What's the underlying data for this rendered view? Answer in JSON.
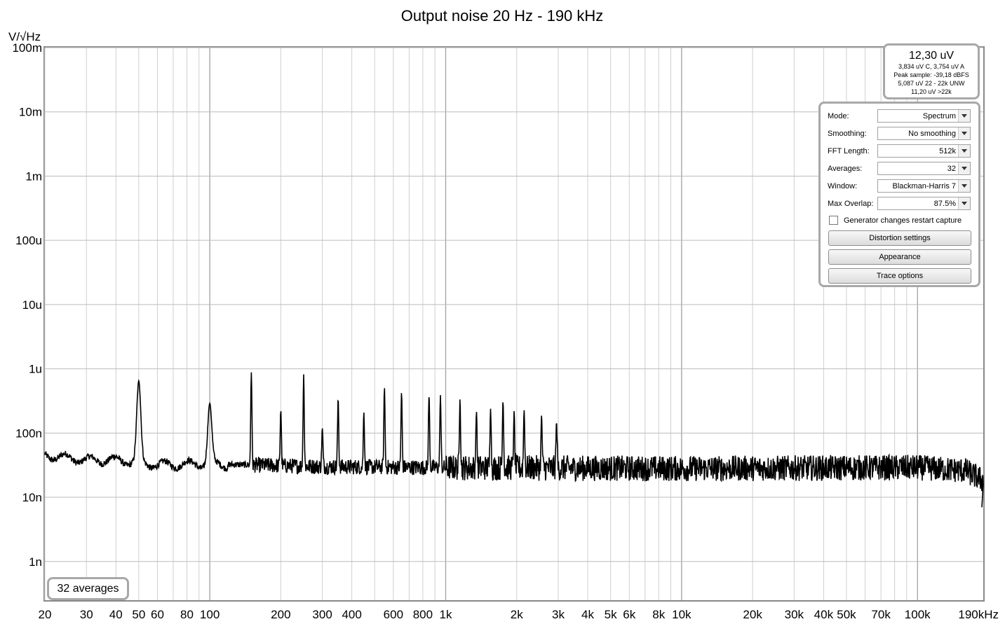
{
  "chart_data": {
    "type": "line",
    "title": "Output noise 20 Hz - 190 kHz",
    "ylabel": "V/√Hz",
    "xlabel": "",
    "x_scale": "log",
    "y_scale": "log",
    "xlim": [
      20,
      190000
    ],
    "ylim": [
      2.5e-10,
      0.1
    ],
    "grid": true,
    "x_ticks": [
      {
        "v": 20,
        "label": "20"
      },
      {
        "v": 30,
        "label": "30"
      },
      {
        "v": 40,
        "label": "40"
      },
      {
        "v": 50,
        "label": "50"
      },
      {
        "v": 60,
        "label": "60"
      },
      {
        "v": 80,
        "label": "80"
      },
      {
        "v": 100,
        "label": "100"
      },
      {
        "v": 200,
        "label": "200"
      },
      {
        "v": 300,
        "label": "300"
      },
      {
        "v": 400,
        "label": "400"
      },
      {
        "v": 600,
        "label": "600"
      },
      {
        "v": 800,
        "label": "800"
      },
      {
        "v": 1000,
        "label": "1k"
      },
      {
        "v": 2000,
        "label": "2k"
      },
      {
        "v": 3000,
        "label": "3k"
      },
      {
        "v": 4000,
        "label": "4k"
      },
      {
        "v": 5000,
        "label": "5k"
      },
      {
        "v": 6000,
        "label": "6k"
      },
      {
        "v": 8000,
        "label": "8k"
      },
      {
        "v": 10000,
        "label": "10k"
      },
      {
        "v": 20000,
        "label": "20k"
      },
      {
        "v": 30000,
        "label": "30k"
      },
      {
        "v": 40000,
        "label": "40k"
      },
      {
        "v": 50000,
        "label": "50k"
      },
      {
        "v": 70000,
        "label": "70k"
      },
      {
        "v": 100000,
        "label": "100k"
      },
      {
        "v": 190000,
        "label": "190kHz"
      }
    ],
    "y_ticks": [
      {
        "v": 0.1,
        "label": "100m"
      },
      {
        "v": 0.01,
        "label": "10m"
      },
      {
        "v": 0.001,
        "label": "1m"
      },
      {
        "v": 0.0001,
        "label": "100u"
      },
      {
        "v": 1e-05,
        "label": "10u"
      },
      {
        "v": 1e-06,
        "label": "1u"
      },
      {
        "v": 1e-07,
        "label": "100n"
      },
      {
        "v": 1e-08,
        "label": "10n"
      },
      {
        "v": 1e-09,
        "label": "1n"
      }
    ],
    "series": [
      {
        "floor": [
          [
            20,
            4.5e-08
          ],
          [
            30,
            3.8e-08
          ],
          [
            40,
            3.8e-08
          ],
          [
            60,
            3.2e-08
          ],
          [
            100,
            3.3e-08
          ],
          [
            300,
            3e-08
          ],
          [
            1000,
            2.9e-08
          ],
          [
            10000,
            2.8e-08
          ],
          [
            100000,
            2.9e-08
          ],
          [
            160000,
            2.6e-08
          ],
          [
            190000,
            1.8e-08
          ],
          [
            192000,
            7e-09
          ]
        ],
        "peaks": [
          {
            "f": 50,
            "v": 6.5e-07
          },
          {
            "f": 100,
            "v": 2.9e-07
          },
          {
            "f": 150,
            "v": 8.8e-07
          },
          {
            "f": 200,
            "v": 2.3e-07
          },
          {
            "f": 250,
            "v": 8.2e-07
          },
          {
            "f": 300,
            "v": 1.2e-07
          },
          {
            "f": 350,
            "v": 3.5e-07
          },
          {
            "f": 450,
            "v": 2.1e-07
          },
          {
            "f": 550,
            "v": 5.1e-07
          },
          {
            "f": 650,
            "v": 4.3e-07
          },
          {
            "f": 850,
            "v": 3.9e-07
          },
          {
            "f": 950,
            "v": 3.9e-07
          },
          {
            "f": 1150,
            "v": 3.4e-07
          },
          {
            "f": 1350,
            "v": 2.2e-07
          },
          {
            "f": 1550,
            "v": 2.4e-07
          },
          {
            "f": 1750,
            "v": 3.2e-07
          },
          {
            "f": 1950,
            "v": 2.2e-07
          },
          {
            "f": 2150,
            "v": 2.3e-07
          },
          {
            "f": 2550,
            "v": 1.9e-07
          },
          {
            "f": 2950,
            "v": 1.5e-07
          }
        ]
      }
    ]
  },
  "meter": {
    "main": "12,30 uV",
    "line1": "3,834 uV C, 3,754 uV A",
    "line2": "Peak sample: -39,18 dBFS",
    "line3": "5,087 uV 22 - 22k UNW",
    "line4": "11,20 uV >22k"
  },
  "controls": {
    "mode_label": "Mode:",
    "mode_value": "Spectrum",
    "smoothing_label": "Smoothing:",
    "smoothing_value": "No  smoothing",
    "fft_label": "FFT Length:",
    "fft_value": "512k",
    "averages_label": "Averages:",
    "averages_value": "32",
    "window_label": "Window:",
    "window_value": "Blackman-Harris 7",
    "overlap_label": "Max Overlap:",
    "overlap_value": "87.5%",
    "generator_checkbox_label": "Generator changes restart capture",
    "generator_checked": false,
    "distortion_button": "Distortion settings",
    "appearance_button": "Appearance",
    "trace_button": "Trace options"
  },
  "averages_badge": "32 averages"
}
